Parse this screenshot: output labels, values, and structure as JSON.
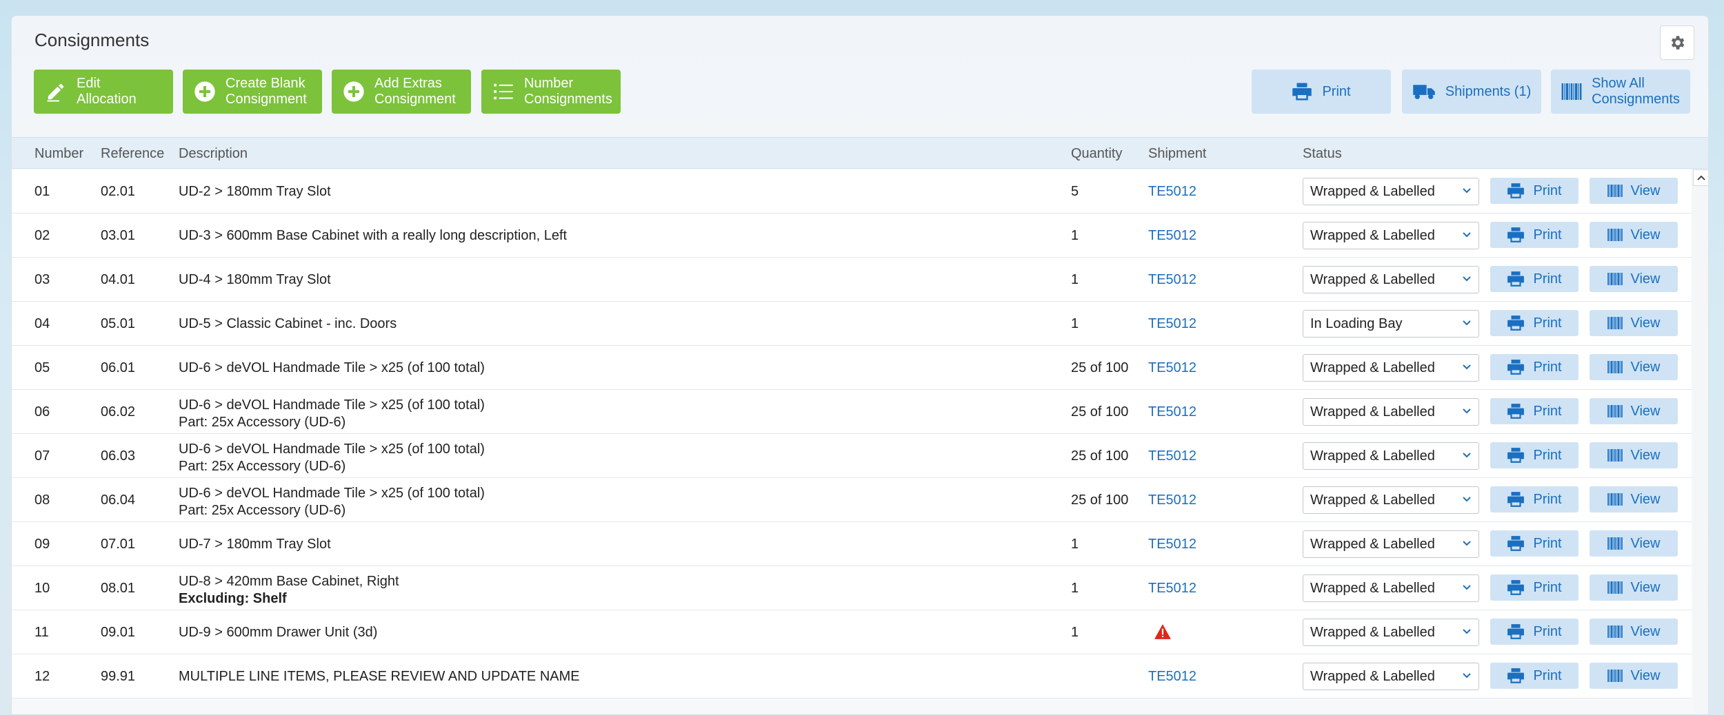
{
  "title": "Consignments",
  "toolbar": {
    "edit_allocation": "Edit Allocation",
    "create_blank_1": "Create Blank",
    "create_blank_2": "Consignment",
    "add_extras_1": "Add Extras",
    "add_extras_2": "Consignment",
    "number_1": "Number",
    "number_2": "Consignments",
    "print": "Print",
    "shipments": "Shipments (1)",
    "show_all_1": "Show All",
    "show_all_2": "Consignments"
  },
  "columns": {
    "number": "Number",
    "reference": "Reference",
    "description": "Description",
    "quantity": "Quantity",
    "shipment": "Shipment",
    "status": "Status"
  },
  "row_buttons": {
    "print": "Print",
    "view": "View"
  },
  "colors": {
    "green": "#7cc23a",
    "blue_btn": "#cfe3f4",
    "link": "#1b6fc0",
    "warning": "#e0251b"
  },
  "rows": [
    {
      "num": "01",
      "ref": "02.01",
      "desc": "UD-2 > 180mm Tray Slot",
      "desc2": "",
      "desc2_bold": "",
      "qty": "5",
      "ship": "TE5012",
      "status": "Wrapped & Labelled"
    },
    {
      "num": "02",
      "ref": "03.01",
      "desc": "UD-3 > 600mm Base Cabinet with a really long description, Left",
      "desc2": "",
      "desc2_bold": "",
      "qty": "1",
      "ship": "TE5012",
      "status": "Wrapped & Labelled"
    },
    {
      "num": "03",
      "ref": "04.01",
      "desc": "UD-4 > 180mm Tray Slot",
      "desc2": "",
      "desc2_bold": "",
      "qty": "1",
      "ship": "TE5012",
      "status": "Wrapped & Labelled"
    },
    {
      "num": "04",
      "ref": "05.01",
      "desc": "UD-5 > Classic Cabinet - inc. Doors",
      "desc2": "",
      "desc2_bold": "",
      "qty": "1",
      "ship": "TE5012",
      "status": "In Loading Bay"
    },
    {
      "num": "05",
      "ref": "06.01",
      "desc": "UD-6 > deVOL Handmade Tile > x25 (of 100 total)",
      "desc2": "",
      "desc2_bold": "",
      "qty": "25 of 100",
      "ship": "TE5012",
      "status": "Wrapped & Labelled"
    },
    {
      "num": "06",
      "ref": "06.02",
      "desc": "UD-6 > deVOL Handmade Tile > x25 (of 100 total)",
      "desc2": "Part: 25x Accessory (UD-6)",
      "desc2_bold": "",
      "qty": "25 of 100",
      "ship": "TE5012",
      "status": "Wrapped & Labelled"
    },
    {
      "num": "07",
      "ref": "06.03",
      "desc": "UD-6 > deVOL Handmade Tile > x25 (of 100 total)",
      "desc2": "Part: 25x Accessory (UD-6)",
      "desc2_bold": "",
      "qty": "25 of 100",
      "ship": "TE5012",
      "status": "Wrapped & Labelled"
    },
    {
      "num": "08",
      "ref": "06.04",
      "desc": "UD-6 > deVOL Handmade Tile > x25 (of 100 total)",
      "desc2": "Part: 25x Accessory (UD-6)",
      "desc2_bold": "",
      "qty": "25 of 100",
      "ship": "TE5012",
      "status": "Wrapped & Labelled"
    },
    {
      "num": "09",
      "ref": "07.01",
      "desc": "UD-7 > 180mm Tray Slot",
      "desc2": "",
      "desc2_bold": "",
      "qty": "1",
      "ship": "TE5012",
      "status": "Wrapped & Labelled"
    },
    {
      "num": "10",
      "ref": "08.01",
      "desc": "UD-8 > 420mm Base Cabinet, Right",
      "desc2": "",
      "desc2_bold": "Excluding: Shelf",
      "qty": "1",
      "ship": "TE5012",
      "status": "Wrapped & Labelled"
    },
    {
      "num": "11",
      "ref": "09.01",
      "desc": "UD-9 > 600mm Drawer Unit (3d)",
      "desc2": "",
      "desc2_bold": "",
      "qty": "1",
      "ship": "",
      "warning": true,
      "status": "Wrapped & Labelled"
    },
    {
      "num": "12",
      "ref": "99.91",
      "desc": "MULTIPLE LINE ITEMS, PLEASE REVIEW AND UPDATE NAME",
      "desc2": "",
      "desc2_bold": "",
      "qty": "",
      "ship": "TE5012",
      "status": "Wrapped & Labelled"
    }
  ]
}
